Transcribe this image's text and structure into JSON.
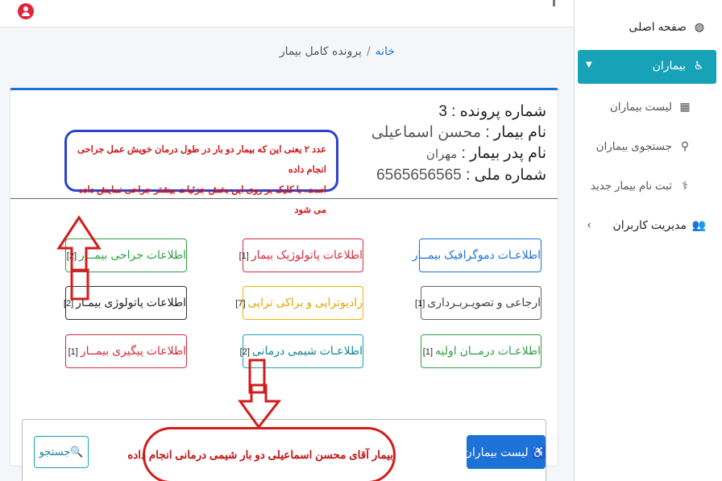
{
  "breadcrumb": {
    "home": "خانه",
    "separator": "/",
    "current": "پرونده کامل بیمار"
  },
  "patient": {
    "file_label": "شماره پرونده :",
    "file_value": "3",
    "name_label": "نام بیمار :",
    "name_value": "محسن اسماعیلی",
    "father_label": "نام پدر بیمار :",
    "father_value": "مهران",
    "national_label": "شماره ملی :",
    "national_value": "6565656565"
  },
  "annotation_top": {
    "line1": "عدد ۲ یعنی این که بیمار دو بار در طول درمان خویش عمل جراحی انجام داده",
    "line2": "است. با کلیک بر روی این بخش جزئیات بیشتر جراحی نمایش داده می شود"
  },
  "annotation_bottom": "بیمار آقای محسن اسماعیلی دو بار شیمی درمانی انجام داده",
  "buttons": {
    "demographic": {
      "label": "اطلاعـات دموگرافیک بیمــار",
      "count": ""
    },
    "pathology_info": {
      "label": "اطلاعات پاتولوژیک بیمار",
      "count": "[1]"
    },
    "surgery": {
      "label": "اطلاعات جراحی بیمــار",
      "count": "[2]"
    },
    "referral_imaging": {
      "label": "ارجاعی و تصویـربـرداری",
      "count": "[1]"
    },
    "radiotherapy": {
      "label": "رادیوتراپی و براکی تراپی",
      "count": "[7]"
    },
    "pathology_patient": {
      "label": "اطلاعات پاتولوژی بیمـار",
      "count": "[2]"
    },
    "primary_treatment": {
      "label": "اطلاعـات درمــان اولیه",
      "count": "[1]"
    },
    "chemotherapy": {
      "label": "اطلاعـات شیمی درمانی",
      "count": "[2]"
    },
    "followup": {
      "label": "اطلاعات پیگیری بیمــار",
      "count": "[1]"
    }
  },
  "footer": {
    "list_button": "لیست بیماران",
    "search_button": "جستجو"
  },
  "sidebar": {
    "home": "صفحه اصلی",
    "patients": "بیماران",
    "patients_list": "لیست بیماران",
    "patients_search": "جستجوی بیماران",
    "patients_new": "ثبت نام بیمار جدید",
    "user_management": "مدیریت کاربران"
  },
  "colors": {
    "primary": "#1d72d8",
    "info": "#17a2b8",
    "danger": "#d52b3a",
    "success": "#2ea043",
    "warning": "#f0b400"
  },
  "icons": [
    "user-circle-icon",
    "dashboard-icon",
    "wheelchair-icon",
    "hospital-icon",
    "search-icon",
    "stethoscope-icon",
    "users-icon",
    "chevron-down-icon",
    "chevron-left-icon",
    "search-plus-icon"
  ]
}
